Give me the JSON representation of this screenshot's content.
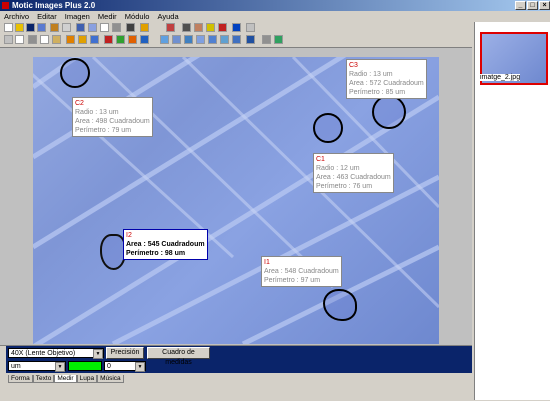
{
  "window": {
    "title": "Motic Images Plus 2.0",
    "min": "_",
    "max": "□",
    "close": "×"
  },
  "menu": [
    "Archivo",
    "Editar",
    "Imagen",
    "Medir",
    "Módulo",
    "Ayuda"
  ],
  "doc_controls": {
    "min": "_",
    "max": "□",
    "close": "×"
  },
  "labels": {
    "c3": {
      "tag": "C3",
      "radio": "Radio : 13 um",
      "area": "Area : 572 Cuadradoum",
      "perimetro": "Perímetro : 85 um"
    },
    "c2": {
      "tag": "C2",
      "radio": "Radio : 13 um",
      "area": "Area : 498 Cuadradoum",
      "perimetro": "Perímetro : 79 um"
    },
    "c1": {
      "tag": "C1",
      "radio": "Radio : 12 um",
      "area": "Area : 463 Cuadradoum",
      "perimetro": "Perímetro : 76 um"
    },
    "i2": {
      "tag": "I2",
      "area": "Area : 545 Cuadradoum",
      "perimetro": "Perímetro : 98 um"
    },
    "i1": {
      "tag": "I1",
      "area": "Area : 548 Cuadradoum",
      "perimetro": "Perímetro : 97 um"
    }
  },
  "thumbnail": {
    "caption": "imatge_2.jpg"
  },
  "bottom": {
    "lens": "40X (Lente Objetivo)",
    "precision_btn": "Precisión",
    "calib_btn": "Cuadro de medidas",
    "unit": "um",
    "line_value": "0",
    "swatch_color": "#00ee00"
  },
  "tabs": [
    "Forma",
    "Texto",
    "Medir",
    "Lupa",
    "Música"
  ]
}
